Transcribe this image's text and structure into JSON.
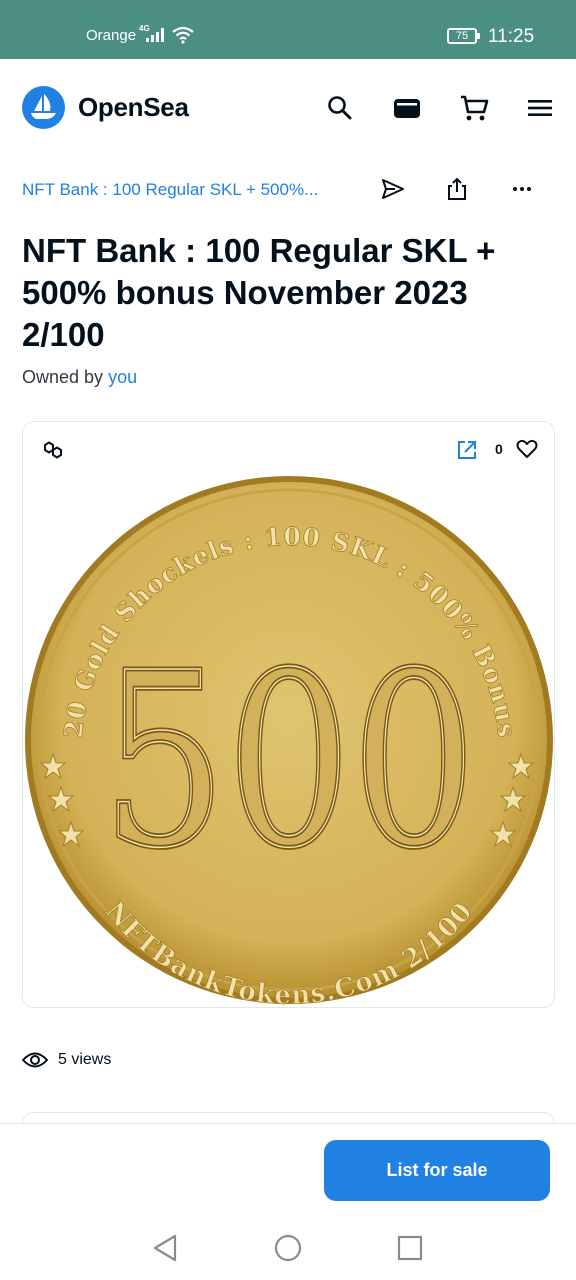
{
  "status_bar": {
    "carrier": "Orange",
    "network": "4G",
    "battery": "75",
    "time": "11:25"
  },
  "header": {
    "brand": "OpenSea"
  },
  "breadcrumb": {
    "collection": "NFT Bank : 100 Regular SKL + 500%..."
  },
  "item": {
    "title": "NFT Bank : 100 Regular SKL + 500% bonus November 2023 2/100",
    "owned_by_label": "Owned by",
    "owner": "you",
    "favorites": "0",
    "views": "5 views"
  },
  "coin": {
    "number": "500",
    "top_text": "20 Gold Shockels : 100 SKL : 500% Bonus",
    "bottom_text": "NFTBankTokens.Com 2/100"
  },
  "footer": {
    "list_button": "List for sale"
  },
  "icons": {
    "logo": "opensea-logo-icon",
    "search": "search-icon",
    "wallet": "wallet-icon",
    "cart": "cart-icon",
    "menu": "menu-icon",
    "transfer": "send-icon",
    "share": "share-icon",
    "more": "more-icon",
    "chain": "polygon-chain-icon",
    "external": "external-link-icon",
    "heart": "heart-icon",
    "eye": "eye-icon"
  },
  "colors": {
    "accent": "#2081e2",
    "status_bar": "#4a8f82",
    "coin_gold": "#d8b85e"
  }
}
